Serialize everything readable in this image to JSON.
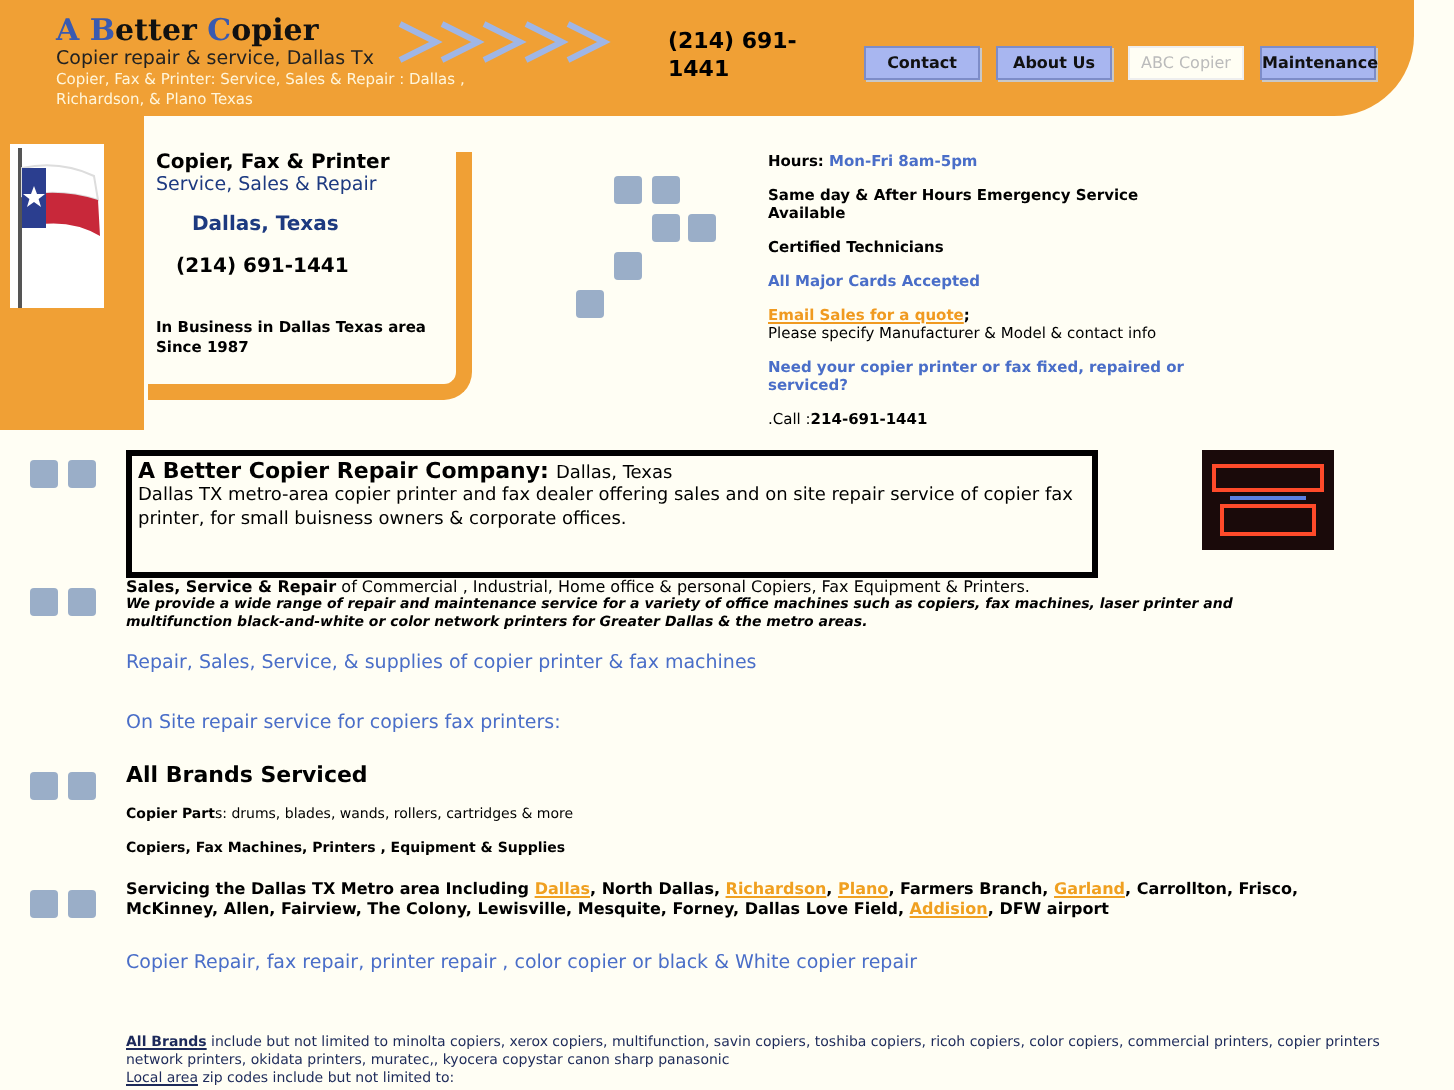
{
  "header": {
    "logo": [
      {
        "text": "A",
        "accent": true
      },
      {
        "text": " B",
        "accent": true
      },
      {
        "text": "etter ",
        "accent": false
      },
      {
        "text": "C",
        "accent": true
      },
      {
        "text": "opier",
        "accent": false
      }
    ],
    "tagline": "Copier repair & service, Dallas Tx",
    "subline": "Copier, Fax & Printer: Service, Sales & Repair  : Dallas , Richardson, & Plano Texas",
    "phone": "(214)  691-1441",
    "nav": [
      {
        "label": "Contact",
        "selected": false
      },
      {
        "label": "About Us",
        "selected": false
      },
      {
        "label": "ABC Copier",
        "selected": true
      },
      {
        "label": "Maintenance",
        "selected": false
      }
    ]
  },
  "intro": {
    "heading": "Copier, Fax & Printer",
    "subheading": "Service, Sales & Repair",
    "city": "Dallas, Texas",
    "phone": "(214)  691-1441",
    "since": "In Business  in Dallas Texas area Since 1987"
  },
  "info": {
    "hours_label": "Hours:",
    "hours": "Mon-Fri 8am-5pm",
    "items": [
      {
        "kind": "bold",
        "text": "Same day & After Hours Emergency Service Available"
      },
      {
        "kind": "bold",
        "text": "Certified Technicians"
      },
      {
        "kind": "blue",
        "text": "All Major Cards Accepted"
      }
    ],
    "email_link": "Email Sales for a quote",
    "email_after": ";",
    "email_note": "Please specify Manufacturer & Model & contact info",
    "question": "Need your copier printer or fax fixed, repaired or serviced?",
    "call": ".Call :**214-691-1441**"
  },
  "company_box": {
    "title": "A Better Copier Repair Company:",
    "location": "Dallas, Texas",
    "text": "Dallas TX metro-area copier printer and fax dealer offering sales and on site repair service  of copier fax printer,  for small buisness owners & corporate offices."
  },
  "sales": {
    "lead": "**Sales, Service & Repair** of Commercial , Industrial, Home office & personal  Copiers, Fax Equipment & Printers.",
    "description": "We provide a wide range of repair and maintenance service for a variety of office machines such as copiers, fax machines, laser printer and multifunction black-and-white or color network printers for Greater Dallas & the metro areas."
  },
  "repair_line": "Repair,  Sales, Service, & supplies of copier printer & fax machines",
  "onsite_line": "On Site repair service for copiers fax printers:",
  "brands_heading": "All Brands Serviced",
  "parts": "**Copier Part**s: drums, blades, wands, rollers, cartridges & more",
  "products": "Copiers, Fax Machines, Printers , Equipment & Supplies",
  "servicing": [
    {
      "text": "Servicing the Dallas  TX Metro area Including ",
      "link": false
    },
    {
      "text": "Dallas",
      "link": true
    },
    {
      "text": ", North Dallas, ",
      "link": false
    },
    {
      "text": "Richardson",
      "link": true
    },
    {
      "text": ", ",
      "link": false
    },
    {
      "text": "Plano",
      "link": true
    },
    {
      "text": ", Farmers Branch, ",
      "link": false
    },
    {
      "text": "Garland",
      "link": true
    },
    {
      "text": ", Carrollton, Frisco, McKinney, Allen, Fairview, The Colony, Lewisville, Mesquite, Forney,  Dallas Love Field, ",
      "link": false
    },
    {
      "text": "Addision",
      "link": true
    },
    {
      "text": ",  DFW airport",
      "link": false
    }
  ],
  "summary_line": "Copier Repair, fax repair, printer repair , color copier or black & White copier repair",
  "brands": {
    "link": "All Brands",
    "text": "  include but not limited to  minolta copiers, xerox copiers, multifunction, savin copiers, toshiba copiers, ricoh copiers, color copiers, commercial printers, copier printers  network printers, okidata printers, muratec,, kyocera copystar canon sharp panasonic"
  },
  "local": {
    "link": "Local area",
    "text": " zip codes include but not limited to:"
  }
}
